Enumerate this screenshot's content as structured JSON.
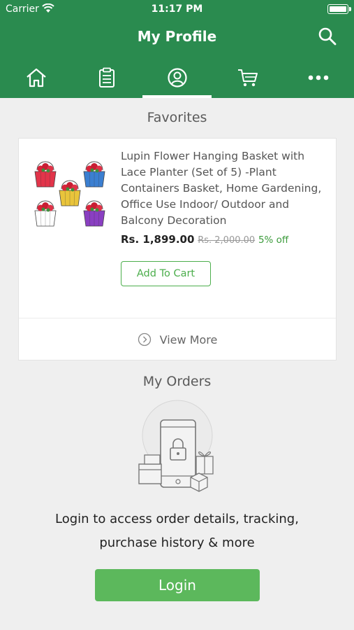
{
  "status_bar": {
    "carrier": "Carrier",
    "time": "11:17 PM"
  },
  "header": {
    "title": "My Profile"
  },
  "tabs": [
    {
      "name": "home",
      "icon": "home-icon"
    },
    {
      "name": "orders",
      "icon": "clipboard-icon"
    },
    {
      "name": "profile",
      "icon": "user-circle-icon",
      "active": true
    },
    {
      "name": "cart",
      "icon": "cart-icon"
    },
    {
      "name": "more",
      "icon": "more-dots-icon"
    }
  ],
  "favorites": {
    "title": "Favorites",
    "product": {
      "title": "Lupin Flower Hanging Basket with Lace Planter (Set of 5) -Plant Containers Basket, Home Gardening, Office Use Indoor/ Outdoor and Balcony Decoration",
      "price": "Rs. 1,899.00",
      "mrp": "Rs. 2,000.00",
      "discount": "5% off",
      "add_to_cart_label": "Add To Cart"
    },
    "view_more_label": "View More"
  },
  "orders": {
    "title": "My Orders",
    "message_line1": "Login to access order details, tracking,",
    "message_line2": "purchase history & more",
    "login_label": "Login"
  },
  "colors": {
    "header_bg": "#2a8b4f",
    "accent_green": "#5cb85c",
    "discount_green": "#3a9a3a",
    "page_bg": "#efefef"
  },
  "product_image_basket_colors": [
    "#e2344a",
    "#3b7fd1",
    "#e9c43b",
    "#ffffff",
    "#8a3fc2"
  ]
}
